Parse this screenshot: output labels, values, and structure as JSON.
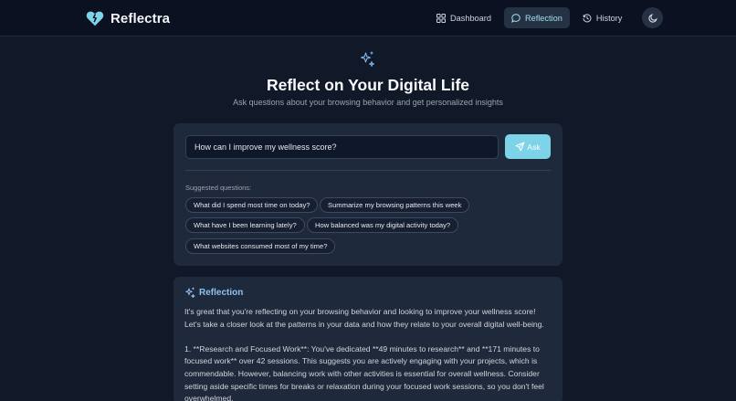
{
  "app": {
    "name": "Reflectra",
    "logo_icon": "heart-icon",
    "accent": "#7dd3e8"
  },
  "nav": {
    "items": [
      {
        "label": "Dashboard",
        "icon": "grid-icon",
        "active": false
      },
      {
        "label": "Reflection",
        "icon": "chat-icon",
        "active": true
      },
      {
        "label": "History",
        "icon": "history-icon",
        "active": false
      }
    ],
    "theme_icon": "moon-icon"
  },
  "hero": {
    "icon": "sparkles-icon",
    "title": "Reflect on Your Digital Life",
    "subtitle": "Ask questions about your browsing behavior and get personalized insights"
  },
  "ask": {
    "input_value": "How can I improve my wellness score?",
    "button_label": "Ask",
    "suggested_label": "Suggested questions:",
    "suggestions": [
      "What did I spend most time on today?",
      "Summarize my browsing patterns this week",
      "What have I been learning lately?",
      "How balanced was my digital activity today?",
      "What websites consumed most of my time?"
    ]
  },
  "reflection": {
    "title": "Reflection",
    "paragraphs": [
      "It's great that you're reflecting on your browsing behavior and looking to improve your wellness score! Let's take a closer look at the patterns in your data and how they relate to your overall digital well-being.",
      "1. **Research and Focused Work**: You've dedicated **49 minutes to research** and **171 minutes to focused work** over 42 sessions. This suggests you are actively engaging with your projects, which is commendable. However, balancing work with other activities is essential for overall wellness. Consider setting aside specific times for breaks or relaxation during your focused work sessions, so you don't feel overwhelmed."
    ]
  }
}
